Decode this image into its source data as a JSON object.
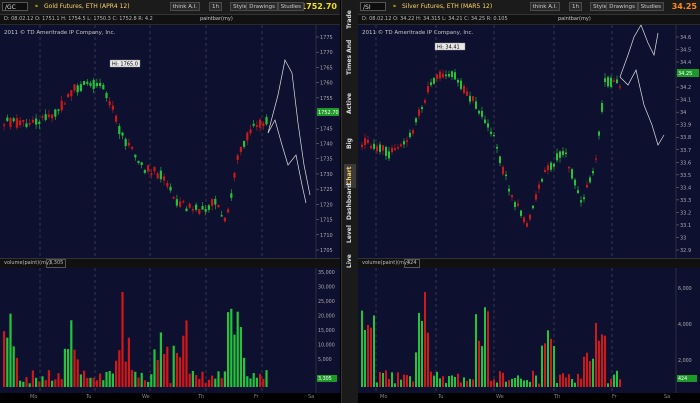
{
  "left": {
    "symbol": "/GC",
    "title": "Gold Futures, ETH (APR4 12)",
    "last_price": "1752.70",
    "think_label": "think A.I.",
    "interval": "1h",
    "buttons": [
      "Style",
      "Drawings",
      "Studies"
    ],
    "ohlc": "D: 08.02.12  O: 1751.1  H: 1754.5  L: 1750.3  C: 1752.8  R: 4.2",
    "extra": "paintbar(my)",
    "copyright": "2011 © TD Ameritrade IP Company, Inc.",
    "hi_label": "Hi: 1765.0",
    "price_axis": [
      "1775",
      "1770",
      "1765",
      "1760",
      "1755",
      "1750",
      "1745",
      "1740",
      "1735",
      "1730",
      "1725",
      "1720",
      "1715",
      "1710",
      "1705"
    ],
    "price_tag": "1752.70",
    "volume_label": "volume(paint)(my)",
    "volume_value": "3,305",
    "volume_axis": [
      "35,000",
      "30,000",
      "25,000",
      "20,000",
      "15,000",
      "10,000",
      "5,000"
    ],
    "volume_tag": "3,305",
    "date_axis": [
      "Mo",
      "Tu",
      "We",
      "Th",
      "Fr",
      "Sa"
    ]
  },
  "right": {
    "symbol": "/SI",
    "title": "Silver Futures, ETH (MAR5 12)",
    "last_price": "34.25",
    "think_label": "think A.I.",
    "interval": "1h",
    "buttons": [
      "Style",
      "Drawings",
      "Studies"
    ],
    "ohlc": "D: 08.02.12  O: 34.22  H: 34.315  L: 34.21  C: 34.25  R: 0.105",
    "extra": "paintbar(my)",
    "copyright": "2011 © TD Ameritrade IP Company, Inc.",
    "hi_label": "Hi: 34.41",
    "price_axis": [
      "34.6",
      "34.5",
      "34.4",
      "34.3",
      "34.2",
      "34.1",
      "34",
      "33.9",
      "33.8",
      "33.7",
      "33.6",
      "33.5",
      "33.4",
      "33.3",
      "33.2",
      "33.1",
      "33",
      "32.9"
    ],
    "price_tag": "34.25",
    "volume_label": "volume(paint)(my)",
    "volume_value": "424",
    "volume_axis": [
      "6,000",
      "4,000",
      "2,000"
    ],
    "volume_tag": "424",
    "date_axis": [
      "Mo",
      "Tu",
      "We",
      "Th",
      "Fr",
      "Sa"
    ]
  },
  "side_tabs": [
    "Trade",
    "Times And Sales",
    "Active Trader",
    "Big Buttons",
    "Chart",
    "Dashboard",
    "Level II",
    "Live News"
  ],
  "colors": {
    "up": "#22c43a",
    "down": "#d01818",
    "background": "#0e1030",
    "panel": "#000000",
    "gold_price": "#f0e020",
    "silver_price": "#ff8a20"
  },
  "icons": [
    "search-icon",
    "gear-icon",
    "link-icon"
  ]
}
